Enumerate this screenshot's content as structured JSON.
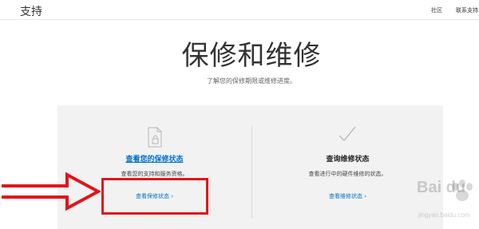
{
  "header": {
    "brand": "支持",
    "nav": [
      "社区",
      "联系支持"
    ]
  },
  "main": {
    "title": "保修和维修",
    "subtitle": "了解您的保修期限或维修进度。"
  },
  "cards": [
    {
      "icon": "document-lock-icon",
      "title": "查看您的保修状态",
      "description": "查看您的支持和服务资格。",
      "link": "查看保修状态 ›"
    },
    {
      "icon": "checkmark-icon",
      "title": "查询维修状态",
      "description": "查看进行中的硬件维修的状态。",
      "link": "查看维修状态 ›"
    }
  ],
  "annotations": {
    "arrow_color": "#e0161b",
    "box_color": "#e0161b"
  },
  "watermark": {
    "text": "Bai du",
    "sub": "jingyan.baidu.com"
  },
  "colors": {
    "link": "#0070c9",
    "panel": "#f2f2f2"
  }
}
